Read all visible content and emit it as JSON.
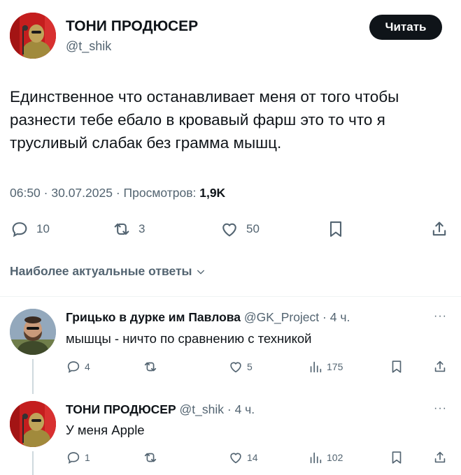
{
  "tweet": {
    "author_name": "ТОНИ ПРОДЮСЕР",
    "author_handle": "@t_shik",
    "follow_label": "Читать",
    "text": "Единственное что останавливает меня от того чтобы разнести тебе ебало в кровавый фарш это то что я трусливый слабак без грамма мышц.",
    "time": "06:50",
    "date": "30.07.2025",
    "views_label": "Просмотров:",
    "views_count": "1,9K",
    "separator": "·",
    "actions": {
      "replies": "10",
      "reposts": "3",
      "likes": "50"
    }
  },
  "sort_label": "Наиболее актуальные ответы",
  "replies": [
    {
      "name": "Грицько в дурке им Павлова",
      "handle": "@GK_Project",
      "time": "4 ч.",
      "text": "мышцы - ничто по сравнению с техникой",
      "replies": "4",
      "likes": "5",
      "views": "175"
    },
    {
      "name": "ТОНИ ПРОДЮСЕР",
      "handle": "@t_shik",
      "time": "4 ч.",
      "text": "У меня Apple",
      "replies": "1",
      "likes": "14",
      "views": "102"
    }
  ],
  "colors": {
    "text": "#0f1419",
    "muted": "#536471",
    "divider": "#eff3f4",
    "button": "#0f1419",
    "avatar_bg": "#c41e1e"
  },
  "icons": [
    "reply-icon",
    "repost-icon",
    "like-icon",
    "bookmark-icon",
    "share-icon",
    "views-icon",
    "chevron-down-icon",
    "more-icon"
  ]
}
